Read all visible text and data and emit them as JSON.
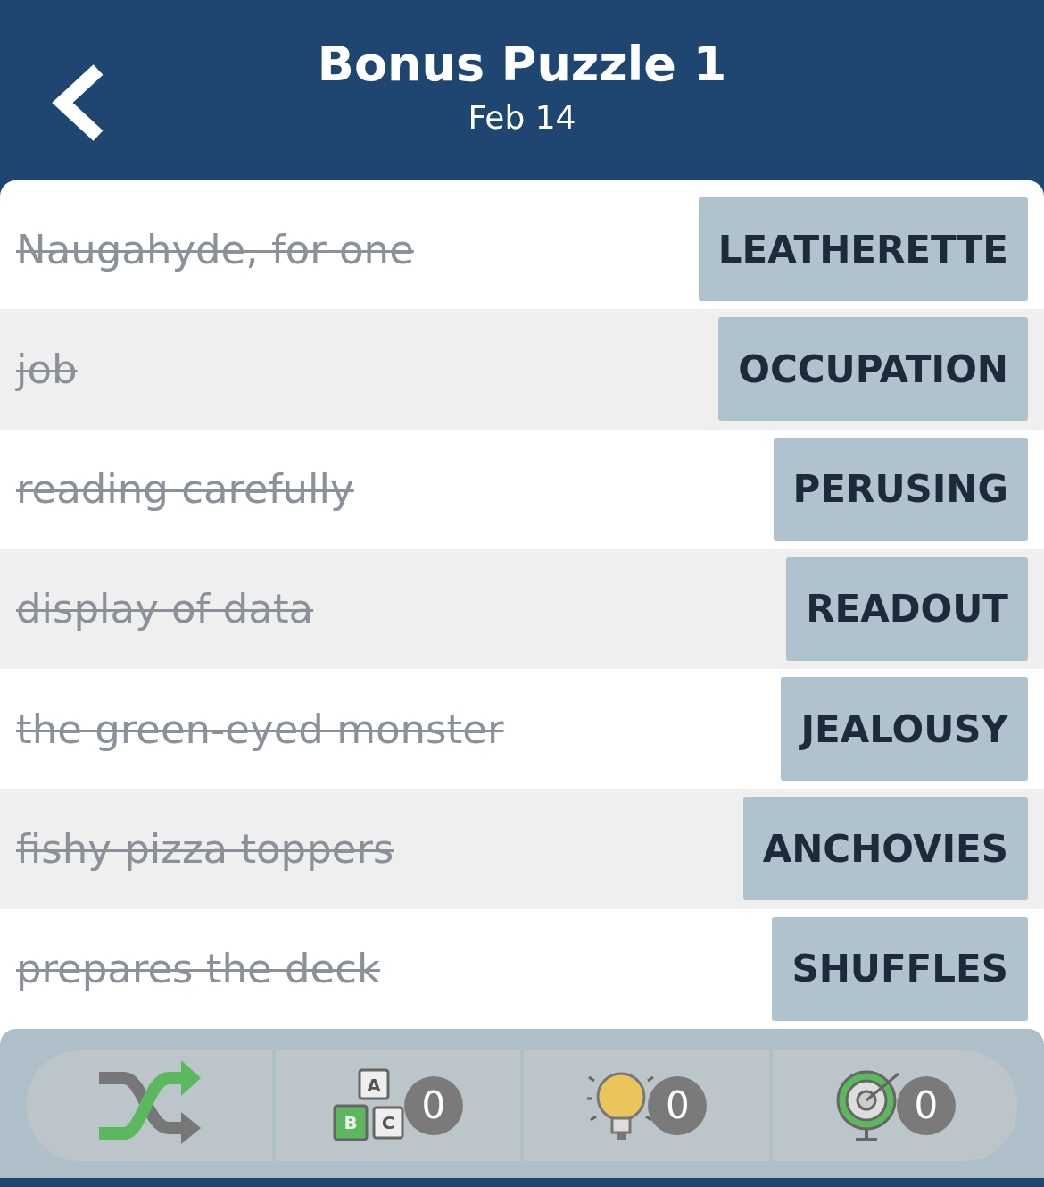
{
  "header": {
    "title": "Bonus Puzzle 1",
    "subtitle": "Feb 14"
  },
  "clues": [
    {
      "clue": "Naugahyde, for one",
      "answer": "LEATHERETTE",
      "solved": true
    },
    {
      "clue": "job",
      "answer": "OCCUPATION",
      "solved": true
    },
    {
      "clue": "reading carefully",
      "answer": "PERUSING",
      "solved": true
    },
    {
      "clue": "display of data",
      "answer": "READOUT",
      "solved": true
    },
    {
      "clue": "the green-eyed monster",
      "answer": "JEALOUSY",
      "solved": true
    },
    {
      "clue": "fishy pizza toppers",
      "answer": "ANCHOVIES",
      "solved": true
    },
    {
      "clue": "prepares the deck",
      "answer": "SHUFFLES",
      "solved": true
    }
  ],
  "toolbar": [
    {
      "kind": "shuffle"
    },
    {
      "kind": "letters",
      "count": "0",
      "letters": [
        "A",
        "B",
        "C"
      ]
    },
    {
      "kind": "hint",
      "count": "0"
    },
    {
      "kind": "target",
      "count": "0"
    }
  ]
}
